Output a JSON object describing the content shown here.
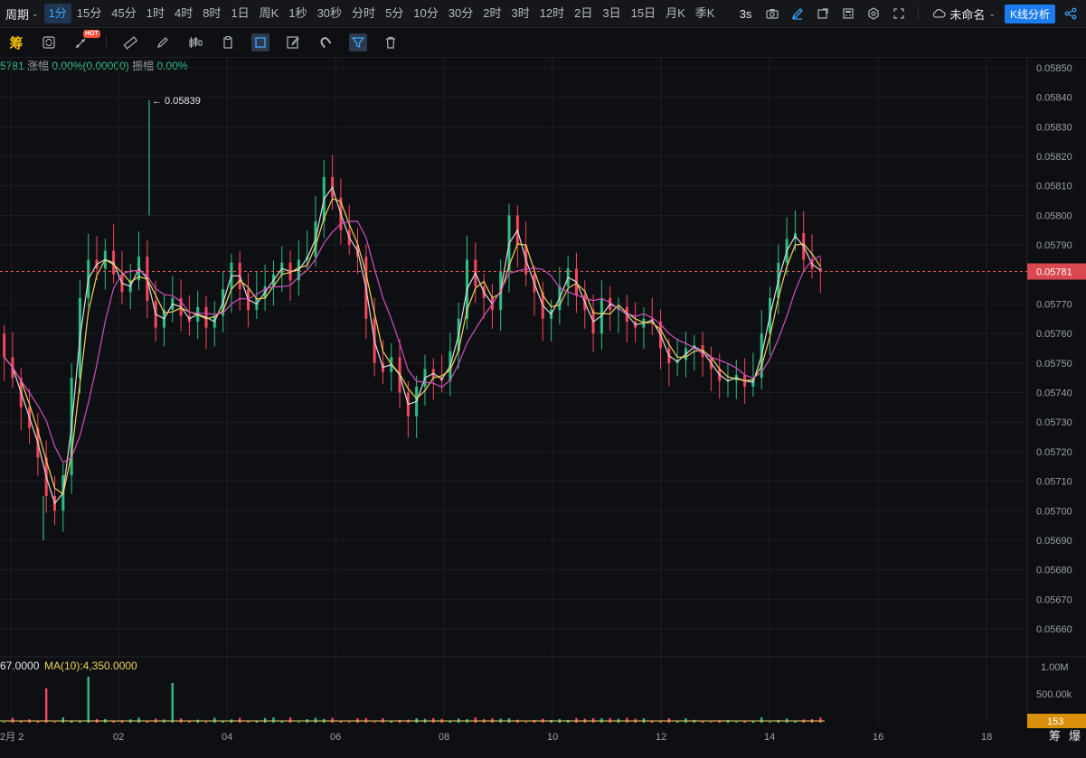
{
  "topbar": {
    "period_label": "周期",
    "timeframes": [
      "1分",
      "15分",
      "45分",
      "1时",
      "4时",
      "8时",
      "1日",
      "周K",
      "1秒",
      "30秒",
      "分时",
      "5分",
      "10分",
      "30分",
      "2时",
      "3时",
      "12时",
      "2日",
      "3日",
      "15日",
      "月K",
      "季K"
    ],
    "active_timeframe": "1分",
    "refresh_rate": "3s",
    "layout_name": "未命名",
    "kline_analysis": "K线分析"
  },
  "toolbar": {
    "chou_label": "筹",
    "hot_badge": "HOT"
  },
  "info": {
    "price_fragment": "5781",
    "change_label": "涨幅",
    "change_value": "0.00%(0.00000)",
    "amplitude_label": "振幅",
    "amplitude_value": "0.00%"
  },
  "main_chart": {
    "current_price": "0.05781",
    "high_marker": "← 0.05839",
    "price_ticks": [
      "0.05850",
      "0.05840",
      "0.05830",
      "0.05820",
      "0.05810",
      "0.05800",
      "0.05790",
      "0.05770",
      "0.05760",
      "0.05750",
      "0.05740",
      "0.05730",
      "0.05720",
      "0.05710",
      "0.05700",
      "0.05690",
      "0.05680",
      "0.05670",
      "0.05660"
    ],
    "x_ticks": [
      "2月 2",
      "02",
      "04",
      "06",
      "08",
      "10",
      "12",
      "14",
      "16",
      "18"
    ],
    "colors": {
      "up": "#2ebd85",
      "down": "#f6465d",
      "ma_fast": "#f0d35a",
      "ma_mid": "#d9d9d9",
      "ma_slow": "#d14fc1",
      "price_line": "#e05a5a",
      "price_tag": "#d9474f"
    }
  },
  "volume": {
    "ma_fragment": "67.0000",
    "ma10_label": "MA(10):4,350.0000",
    "ticks": [
      "1.00M",
      "500.00k"
    ],
    "current_volume": "153"
  },
  "right_bottom": {
    "chou": "筹",
    "bao": "爆"
  },
  "chart_data": {
    "type": "candlestick",
    "title": "",
    "ylim": [
      0.05655,
      0.05855
    ],
    "last_price": 0.05781,
    "period_high": 0.05839,
    "period_low": 0.0569,
    "close_series": [
      0.05752,
      0.05745,
      0.05735,
      0.05728,
      0.05718,
      0.05705,
      0.057,
      0.05712,
      0.05745,
      0.05772,
      0.05785,
      0.05782,
      0.05788,
      0.0578,
      0.05774,
      0.05778,
      0.05786,
      0.05771,
      0.05762,
      0.05768,
      0.05772,
      0.05766,
      0.05764,
      0.05769,
      0.05762,
      0.05766,
      0.05775,
      0.05784,
      0.05775,
      0.05768,
      0.05772,
      0.05776,
      0.0578,
      0.05784,
      0.05778,
      0.05785,
      0.05786,
      0.05798,
      0.05813,
      0.05806,
      0.05795,
      0.0579,
      0.05786,
      0.05765,
      0.0575,
      0.05747,
      0.05752,
      0.0574,
      0.05732,
      0.05742,
      0.05748,
      0.05745,
      0.05744,
      0.05754,
      0.05765,
      0.05785,
      0.05776,
      0.05772,
      0.05768,
      0.05781,
      0.058,
      0.0579,
      0.0578,
      0.05774,
      0.05765,
      0.05768,
      0.05776,
      0.05782,
      0.05773,
      0.05768,
      0.0576,
      0.05772,
      0.05768,
      0.05769,
      0.05764,
      0.05762,
      0.05765,
      0.05764,
      0.05755,
      0.0575,
      0.05751,
      0.05755,
      0.05756,
      0.05752,
      0.05748,
      0.05744,
      0.05744,
      0.05746,
      0.05742,
      0.05745,
      0.0576,
      0.05772,
      0.05784,
      0.05792,
      0.05794,
      0.05785,
      0.05782,
      0.05781
    ]
  }
}
